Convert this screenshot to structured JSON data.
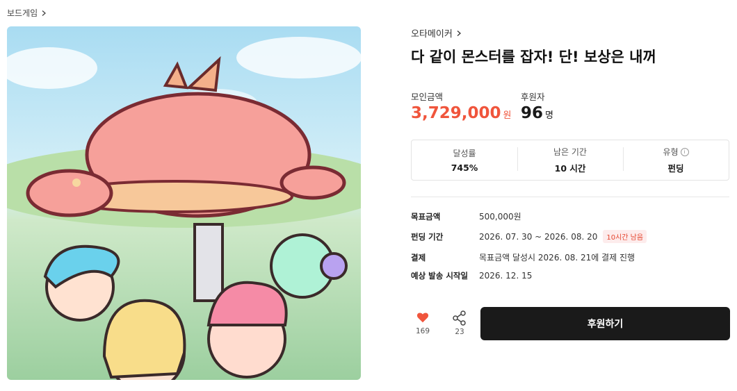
{
  "breadcrumb": {
    "category": "보드게임"
  },
  "project": {
    "creator": "오타메이커",
    "title": "다 같이 몬스터를 잡자! 단! 보상은 내꺼"
  },
  "stats": {
    "funding_label": "모인금액",
    "funding_value": "3,729,000",
    "funding_unit": "원",
    "backers_label": "후원자",
    "backers_value": "96",
    "backers_unit": "명"
  },
  "info": {
    "rate_label": "달성률",
    "rate_value": "745%",
    "remaining_label": "남은 기간",
    "remaining_value": "10 시간",
    "type_label": "유형",
    "type_info_glyph": "i",
    "type_value": "펀딩"
  },
  "details": {
    "goal_key": "목표금액",
    "goal_value": "500,000원",
    "period_key": "펀딩 기간",
    "period_value": "2026. 07. 30 ~ 2026. 08. 20",
    "period_tag": "10시간 남음",
    "payment_key": "결제",
    "payment_value": "목표금액 달성시 2026. 08. 21에 결제 진행",
    "ship_key": "예상 발송 시작일",
    "ship_value": "2026. 12. 15"
  },
  "actions": {
    "like_count": "169",
    "share_count": "23",
    "back_label": "후원하기"
  },
  "colors": {
    "accent": "#f0553c",
    "button": "#1a1a1a",
    "heart": "#f0553c"
  },
  "icons": [
    "chevron-right-icon",
    "heart-icon",
    "share-icon",
    "info-icon"
  ]
}
